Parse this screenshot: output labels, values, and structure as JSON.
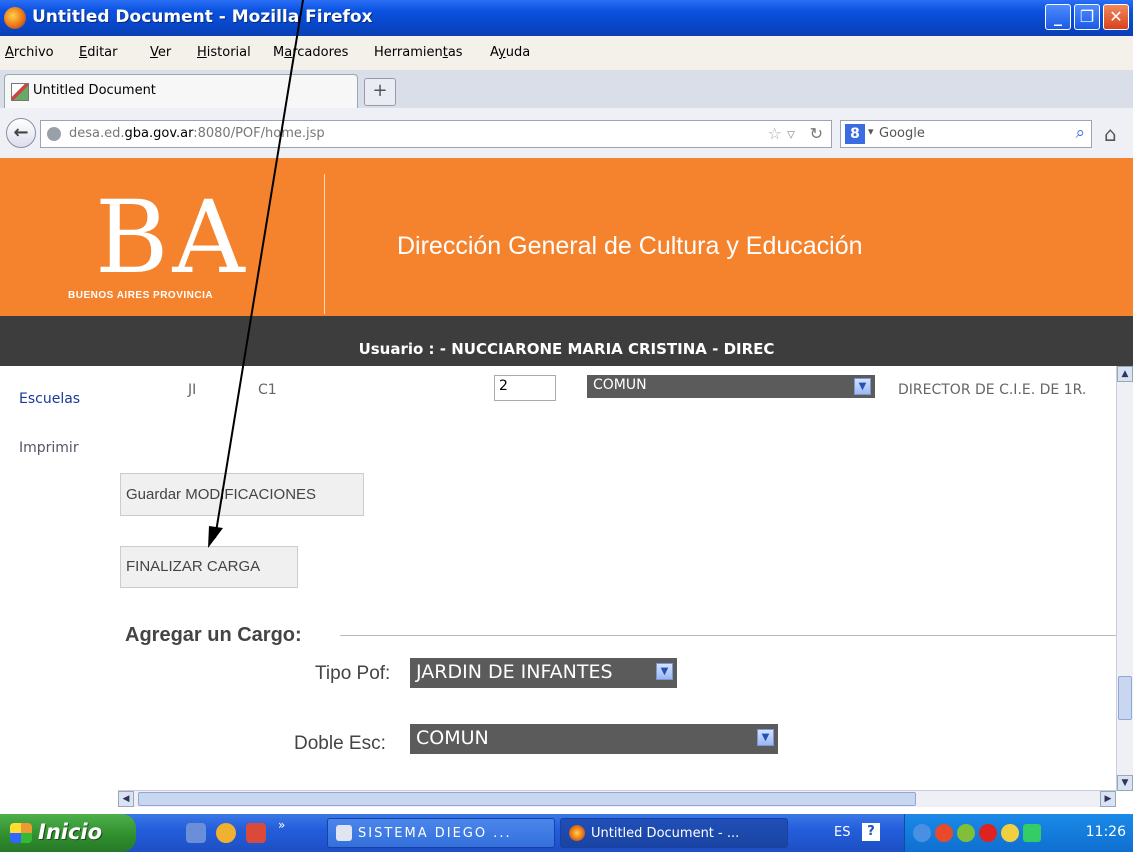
{
  "window": {
    "title": "Untitled Document - Mozilla Firefox"
  },
  "menu": {
    "items": [
      {
        "pre": "",
        "u": "A",
        "post": "rchivo"
      },
      {
        "pre": "",
        "u": "E",
        "post": "ditar"
      },
      {
        "pre": "",
        "u": "V",
        "post": "er"
      },
      {
        "pre": "",
        "u": "H",
        "post": "istorial"
      },
      {
        "pre": "M",
        "u": "a",
        "post": "rcadores"
      },
      {
        "pre": "Herramien",
        "u": "t",
        "post": "as"
      },
      {
        "pre": "A",
        "u": "y",
        "post": "uda"
      }
    ]
  },
  "tab": {
    "label": "Untitled Document",
    "new_tab": "+"
  },
  "nav": {
    "url_prefix": "desa.ed.",
    "url_host": "gba.gov.ar",
    "url_suffix": ":8080/POF/home.jsp",
    "search_placeholder": "Google",
    "search_engine_letter": "8"
  },
  "banner": {
    "logo": "BA",
    "logo_sub": "BUENOS AIRES PROVINCIA",
    "title": "Dirección General de Cultura y Educación"
  },
  "userbar": {
    "text": "Usuario : - NUCCIARONE MARIA CRISTINA - DIREC"
  },
  "sidebar": {
    "items": [
      {
        "label": "Escuelas"
      },
      {
        "label": "Imprimir"
      }
    ]
  },
  "row": {
    "col1": "JI",
    "col2": "C1",
    "qty": "2",
    "type": "COMUN",
    "role": "DIRECTOR DE C.I.E. DE 1R."
  },
  "buttons": {
    "save": "Guardar MODIFICACIONES",
    "finish": "FINALIZAR CARGA"
  },
  "form": {
    "legend": "Agregar un Cargo:",
    "tipo_pof_label": "Tipo Pof:",
    "tipo_pof_value": "JARDIN DE INFANTES",
    "doble_esc_label": "Doble Esc:",
    "doble_esc_value": "COMUN"
  },
  "taskbar": {
    "start": "Inicio",
    "tasks": [
      {
        "label": "SISTEMA DIEGO ..."
      },
      {
        "label": "Untitled Document - ..."
      }
    ],
    "lang": "ES",
    "clock": "11:26"
  },
  "colors": {
    "banner_orange": "#f5832d",
    "userbar_dark": "#3d3d3d",
    "dropdown_gray": "#5b5b5b",
    "xp_blue": "#0a52e0"
  }
}
